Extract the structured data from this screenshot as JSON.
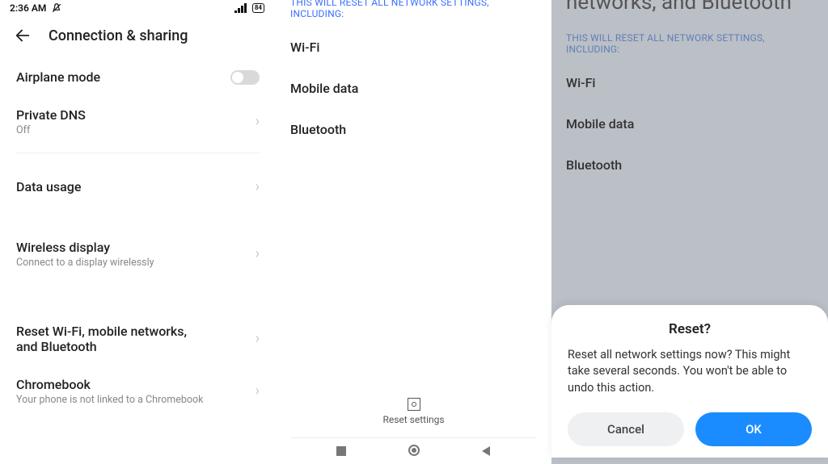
{
  "phone1": {
    "status": {
      "time": "2:36 AM",
      "battery_text": "84"
    },
    "title": "Connection & sharing",
    "items": {
      "airplane": {
        "label": "Airplane mode"
      },
      "dns": {
        "label": "Private DNS",
        "sub": "Off"
      },
      "usage": {
        "label": "Data usage"
      },
      "wdisplay": {
        "label": "Wireless display",
        "sub": "Connect to a display wirelessly"
      },
      "reset": {
        "label": "Reset Wi-Fi, mobile networks, and Bluetooth"
      },
      "chrome": {
        "label": "Chromebook",
        "sub": "Your phone is not linked to a Chromebook"
      }
    }
  },
  "phone2": {
    "section_header": "THIS WILL RESET ALL NETWORK SETTINGS, INCLUDING:",
    "net": {
      "wifi": "Wi-Fi",
      "mobile": "Mobile data",
      "bt": "Bluetooth"
    },
    "reset_btn": "Reset settings"
  },
  "phone3": {
    "big_title_cut": "networks, and Bluetooth",
    "section_header": "THIS WILL RESET ALL NETWORK SETTINGS, INCLUDING:",
    "net": {
      "wifi": "Wi-Fi",
      "mobile": "Mobile data",
      "bt": "Bluetooth"
    },
    "dialog": {
      "title": "Reset?",
      "message": "Reset all network settings now? This might take several seconds. You won't be able to undo this action.",
      "cancel": "Cancel",
      "ok": "OK"
    }
  }
}
